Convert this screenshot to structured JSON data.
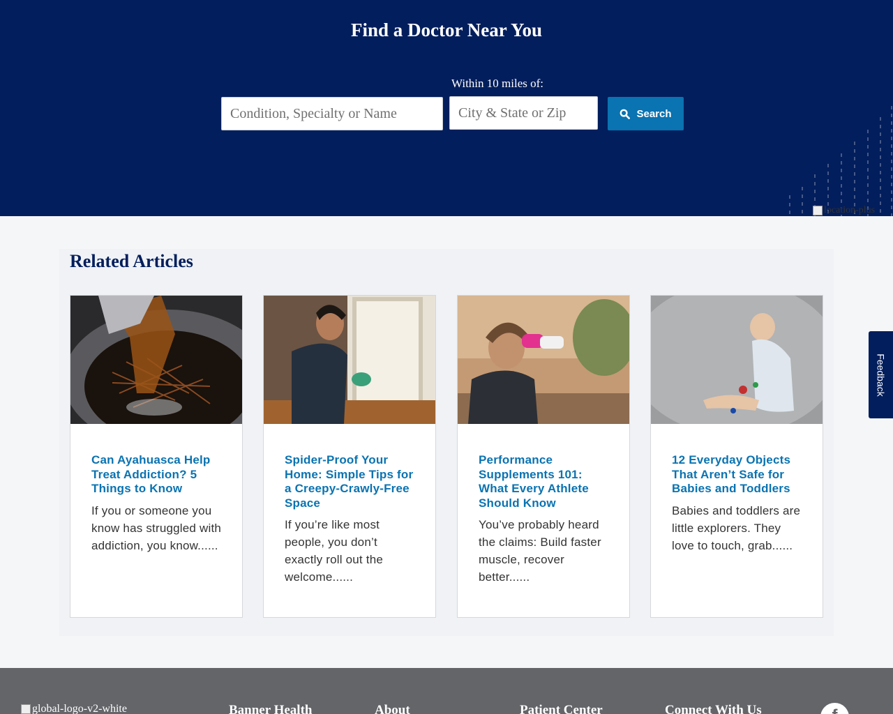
{
  "hero": {
    "title": "Find a Doctor Near You",
    "within_label": "Within 10 miles of:",
    "condition_placeholder": "Condition, Specialty or Name",
    "location_placeholder": "City & State or Zip",
    "search_label": "Search",
    "decor_image_alt": "location-plus"
  },
  "related": {
    "title": "Related Articles",
    "articles": [
      {
        "title": "Can Ayahuasca Help Treat Addiction? 5 Things to Know",
        "excerpt": "If you or someone you know has struggled with addiction, you know......"
      },
      {
        "title": "Spider-Proof Your Home: Simple Tips for a Creepy-Crawly-Free Space",
        "excerpt": "If you’re like most people, you don’t exactly roll out the welcome......"
      },
      {
        "title": "Performance Supplements 101: What Every Athlete Should Know",
        "excerpt": "You’ve probably heard the claims: Build faster muscle, recover better......"
      },
      {
        "title": "12 Everyday Objects That Aren’t Safe for Babies and Toddlers",
        "excerpt": "Babies and toddlers are little explorers. They love to touch, grab......"
      }
    ]
  },
  "feedback_label": "Feedback",
  "footer": {
    "logo_alt": "global-logo-v2-white",
    "headings": [
      "Banner Health",
      "About",
      "Patient Center",
      "Connect With Us"
    ],
    "social_icon": "facebook-icon"
  },
  "colors": {
    "navy": "#031e5c",
    "accent_blue": "#0a73b1",
    "footer_gray": "#636569"
  }
}
